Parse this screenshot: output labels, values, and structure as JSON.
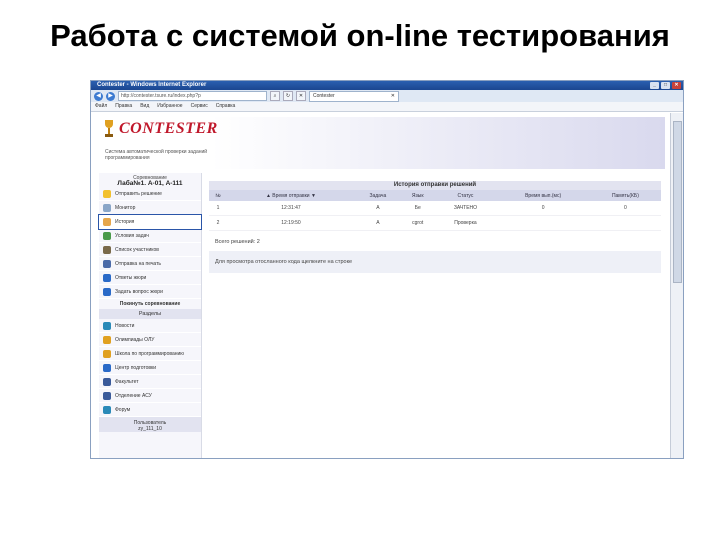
{
  "slide": {
    "title": "Работа с системой on-line тестирования"
  },
  "browser": {
    "window_title": "Contester - Windows Internet Explorer",
    "url": "http://contester.tsure.ru/index.php?p",
    "tab_label": "Contester",
    "menu": [
      "Файл",
      "Правка",
      "Вид",
      "Избранное",
      "Сервис",
      "Справка"
    ],
    "win_buttons": [
      "_",
      "□",
      "✕"
    ],
    "nav_back": "◀",
    "nav_forward": "▶",
    "tab_close": "✕"
  },
  "site": {
    "logo": "CONTESTER",
    "tagline": "Система автоматической проверки заданий программирования"
  },
  "sidebar": {
    "contest_heading": "Соревнование",
    "contest_name": "Лаба№1. А-01, А-111",
    "items": [
      {
        "label": "Отправить решение",
        "icon": "lightbulb-icon",
        "color": "#f2c12e"
      },
      {
        "label": "Монитор",
        "icon": "monitor-icon",
        "color": "#8aa6c8"
      },
      {
        "label": "История",
        "icon": "diamond-icon",
        "color": "#e6a64a"
      },
      {
        "label": "Условия задач",
        "icon": "book-icon",
        "color": "#4a9a4a"
      },
      {
        "label": "Список участников",
        "icon": "people-icon",
        "color": "#7a6a4a"
      },
      {
        "label": "Отправка на печать",
        "icon": "printer-icon",
        "color": "#4a6aa8"
      },
      {
        "label": "Ответы жюри",
        "icon": "info-icon",
        "color": "#2a6ac8"
      },
      {
        "label": "Задать вопрос жюри",
        "icon": "question-icon",
        "color": "#2a6ac8"
      }
    ],
    "finish_label": "Покинуть соревнование",
    "sections_heading": "Разделы",
    "sections": [
      {
        "label": "Новости",
        "icon": "globe-icon",
        "color": "#2a8ab8"
      },
      {
        "label": "Олимпиады ОЛУ",
        "icon": "trophy-icon",
        "color": "#e0a020"
      },
      {
        "label": "Школа по программированию",
        "icon": "trophy-icon",
        "color": "#e0a020"
      },
      {
        "label": "Центр подготовки",
        "icon": "book-icon",
        "color": "#2a6ac8"
      },
      {
        "label": "Факультет",
        "icon": "building-icon",
        "color": "#3a5a9a"
      },
      {
        "label": "Отделение АСУ",
        "icon": "people-icon",
        "color": "#3a5a9a"
      },
      {
        "label": "Форум",
        "icon": "chat-icon",
        "color": "#2a8ab8"
      }
    ],
    "user_heading": "Пользователь",
    "user_name": "zy_111_10"
  },
  "main": {
    "title": "История отправки решений",
    "columns": [
      "№",
      "▲ Время отправки ▼",
      "Задача",
      "Язык",
      "Статус",
      "Время вып.(мс)",
      "Память(КБ)"
    ],
    "rows": [
      [
        "1",
        "12:31:47",
        "A",
        "Бе",
        "ЗАЧТЕНО",
        "0",
        "0"
      ],
      [
        "2",
        "12:19:50",
        "A",
        "cgrot",
        "Проверка",
        "",
        ""
      ]
    ],
    "total": "Всего решений: 2",
    "hint": "Для просмотра отосланного кода щелкните на строке"
  },
  "colors": {
    "accent": "#c0182b",
    "status_ok": "#2a8a2a",
    "header_band": "#d9d9ee"
  }
}
